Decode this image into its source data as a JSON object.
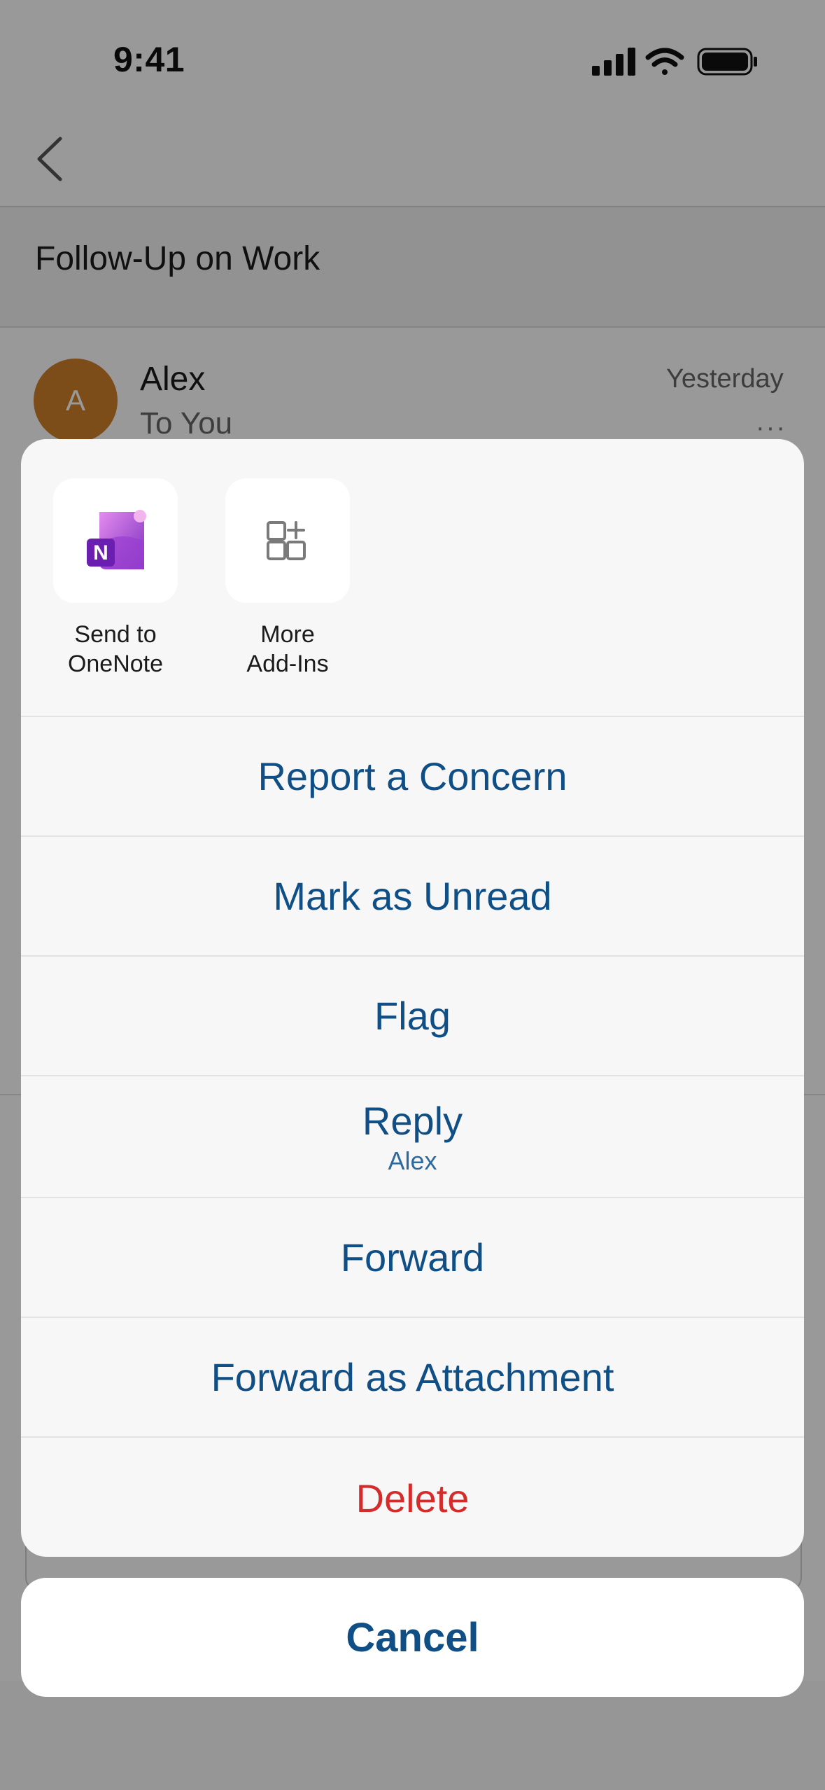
{
  "status_bar": {
    "time": "9:41"
  },
  "email": {
    "subject": "Follow-Up on Work",
    "sender_initial": "A",
    "sender_name": "Alex",
    "recipient": "To You",
    "timestamp": "Yesterday"
  },
  "action_sheet": {
    "addins": [
      {
        "label": "Send to\nOneNote",
        "icon": "onenote-icon"
      },
      {
        "label": "More\nAdd-Ins",
        "icon": "add-ins-grid-icon"
      }
    ],
    "items": [
      {
        "label": "Report a Concern"
      },
      {
        "label": "Mark as Unread"
      },
      {
        "label": "Flag"
      },
      {
        "label": "Reply",
        "sublabel": "Alex"
      },
      {
        "label": "Forward"
      },
      {
        "label": "Forward as Attachment"
      },
      {
        "label": "Delete",
        "destructive": true
      }
    ],
    "cancel_label": "Cancel"
  },
  "colors": {
    "accent": "#0F4F86",
    "destructive": "#D42B2B",
    "avatar": "#D1802A",
    "onenote": "#7B2FBE"
  }
}
